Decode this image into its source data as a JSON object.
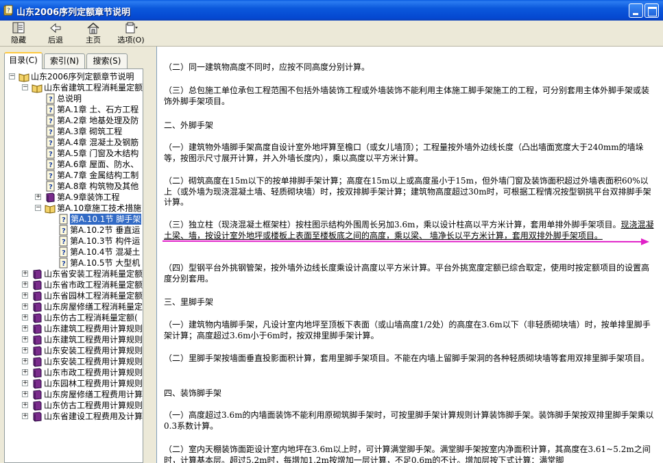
{
  "window": {
    "title": "山东2006序列定额章节说明"
  },
  "toolbar": {
    "hide": "隐藏",
    "back": "后退",
    "home": "主页",
    "options": "选项(O)"
  },
  "tabs": {
    "contents": "目录(C)",
    "index": "索引(N)",
    "search": "搜索(S)"
  },
  "tree": {
    "root": "山东2006序列定额章节说明",
    "group1": "山东省建筑工程消耗量定额",
    "items1": [
      "总说明",
      "第A.1章 土、石方工程",
      "第A.2章 地基处理及防",
      "第A.3章 砌筑工程",
      "第A.4章 混凝土及钢筋",
      "第A.5章 门窗及木结构",
      "第A.6章 屋面、防水、",
      "第A.7章 金属结构工制",
      "第A.8章 构筑物及其他",
      "第A.9章装饰工程",
      "第A.10章施工技术措施"
    ],
    "items2": [
      "第A.10.1节 脚手架",
      "第A.10.2节 垂直运",
      "第A.10.3节 构件运",
      "第A.10.4节 混凝土",
      "第A.10.5节 大型机"
    ],
    "books": [
      "山东省安装工程消耗量定额",
      "山东省市政工程消耗量定额",
      "山东省园林工程消耗量定额",
      "山东房屋修缮工程消耗量定",
      "山东仿古工程消耗量定额(",
      "山东建筑工程费用计算规则",
      "山东建筑工程费用计算规则",
      "山东安装工程费用计算规则",
      "山东安装工程费用计算规则",
      "山东市政工程费用计算规则",
      "山东园林工程费用计算规则",
      "山东房屋修缮工程费用计算",
      "山东仿古工程费用计算规则",
      "山东省建设工程费用及计算"
    ]
  },
  "content": {
    "p1": "（二）同一建筑物高度不同时，应按不同高度分别计算。",
    "p2": "（三）总包施工单位承包工程范围不包括外墙装饰工程或外墙装饰不能利用主体施工脚手架施工的工程，可分别套用主体外脚手架或装饰外脚手架项目。",
    "h1": "二、外脚手架",
    "p3": "（一）建筑物外墙脚手架高度自设计室外地坪算至檐口（或女儿墙顶）；工程量按外墙外边线长度（凸出墙面宽度大于240mm的墙垛等，按图示尺寸展开计算，并入外墙长度内），乘以高度以平方米计算。",
    "p4": "（二）砌筑高度在15m以下的按单排脚手架计算；高度在15m以上或高度虽小于15m，但外墙门窗及装饰面积超过外墙表面积60%以上（或外墙为现浇混凝土墙、轻质砌块墙）时，按双排脚手架计算；建筑物高度超过30m时，可根据工程情况按型钢挑平台双排脚手架计算。",
    "p5a": "（三）独立柱（现浇混凝土框架柱）按柱图示结构外围周长另加3.6m，乘以设计柱高以平方米计算，套用单排外脚手架项目。",
    "p5b": "现浇混凝土梁、墙，按设计室外地坪或楼板上表面至楼板底之间的高度，乘以梁、 墙净长以平方米计算，套用双排外脚手架项目。",
    "p6": "（四）型钢平台外挑钢管架，按外墙外边线长度乘设计高度以平方米计算。平台外挑宽度定额已综合取定，使用时按定额项目的设置高度分别套用。",
    "h2": "三、里脚手架",
    "p7": "（一）建筑物内墙脚手架，凡设计室内地坪至顶板下表面（或山墙高度1/2处）的高度在3.6m以下（非轻质砌块墙）时，按单排里脚手架计算；高度超过3.6m小于6m时，按双排里脚手架计算。",
    "p8": "（二）里脚手架按墙面垂直投影面积计算，套用里脚手架项目。不能在内墙上留脚手架洞的各种轻质砌块墙等套用双排里脚手架项目。",
    "h3": "四、装饰脚手架",
    "p9": "（一）高度超过3.6m的内墙面装饰不能利用原砌筑脚手架时，可按里脚手架计算规则计算装饰脚手架。装饰脚手架按双排里脚手架乘以0.3系数计算。",
    "p10": "（二）室内天棚装饰面距设计室内地坪在3.6m以上时，可计算满堂脚手架。满堂脚手架按室内净面积计算，其高度在3.61~5.2m之间时，计算基本层。超过5.2m时，每增加1.2m按增加一层计算，不足0.6m的不计。增加层按下式计算：满堂脚"
  },
  "colors": {
    "annotation": "#e020c8",
    "titlebar": "#0b58dc",
    "selection": "#316ac5"
  }
}
